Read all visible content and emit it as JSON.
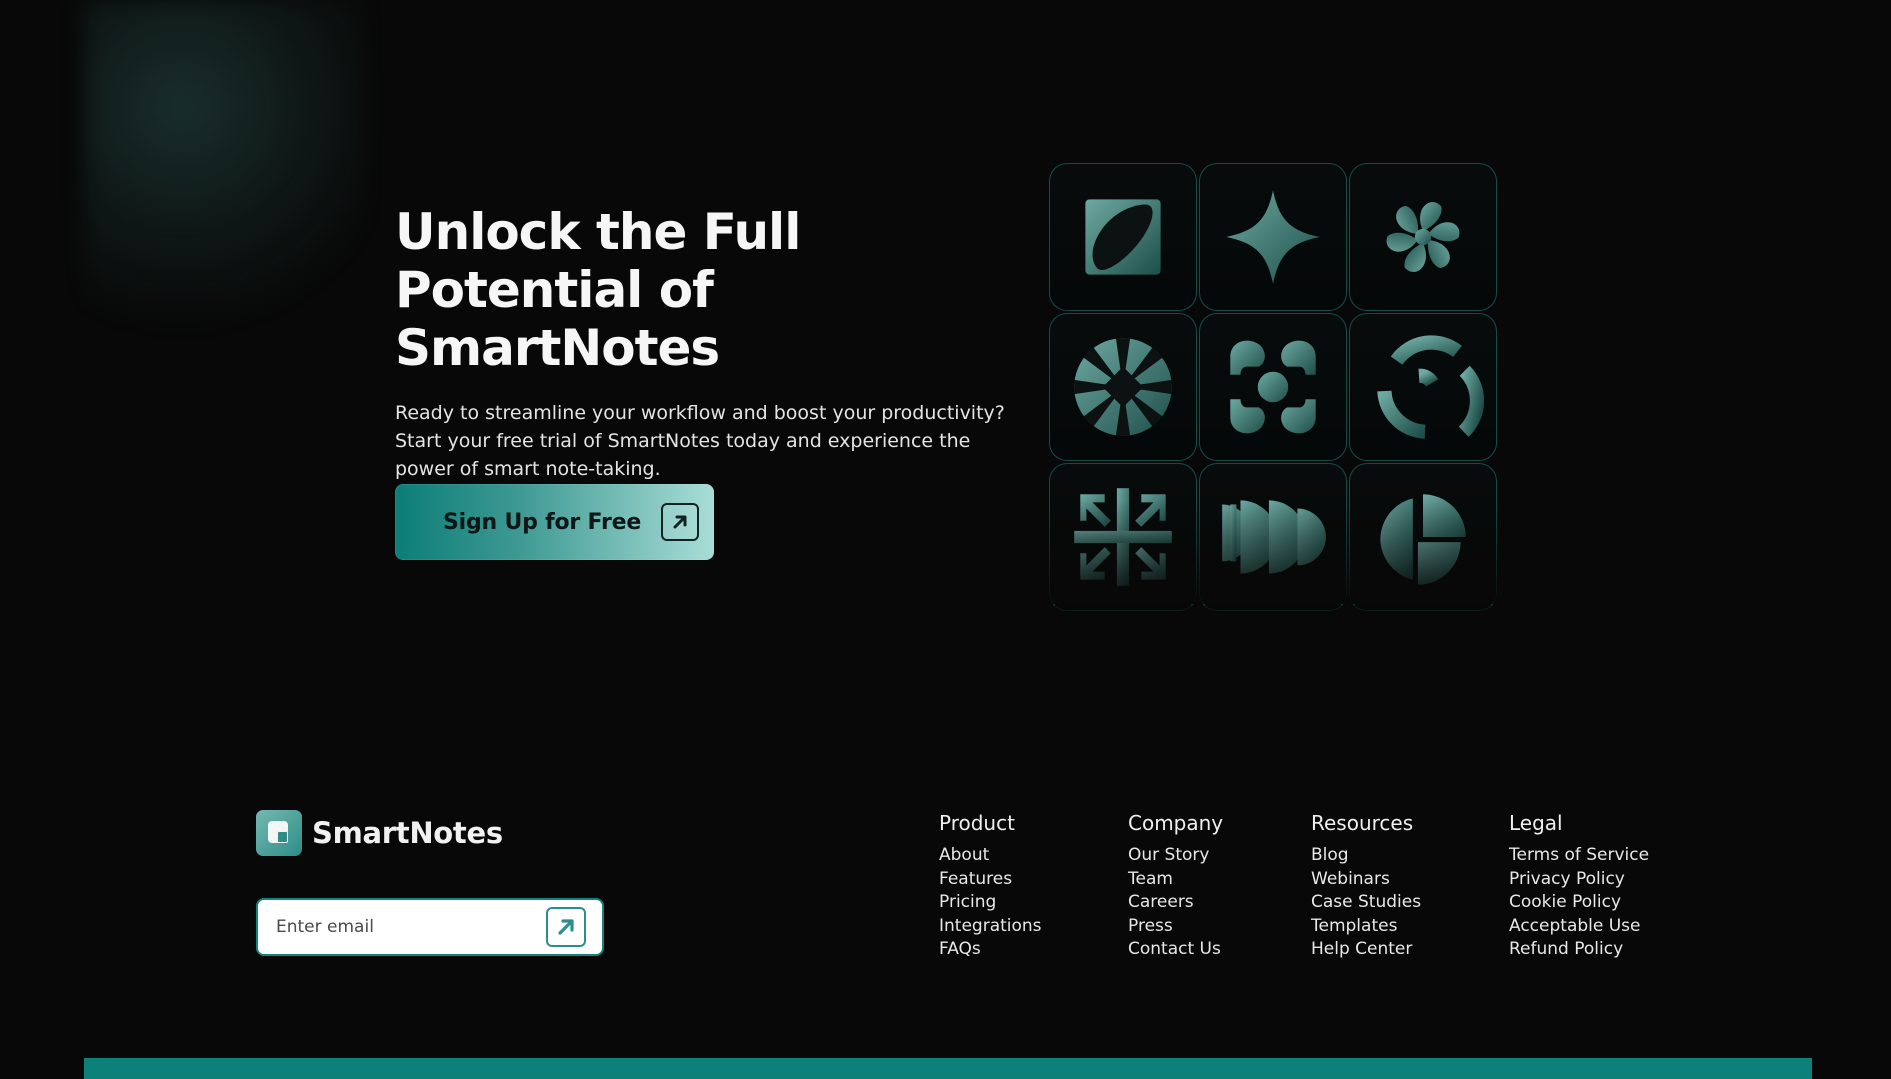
{
  "hero": {
    "title": "Unlock the Full Potential of SmartNotes",
    "description": "Ready to streamline your workflow and boost your productivity? Start your free trial of SmartNotes today and experience the power of smart note-taking.",
    "cta_label": "Sign Up for Free"
  },
  "icons": [
    "abstract-leaf-square-icon",
    "four-point-star-icon",
    "pinwheel-icon",
    "circular-flower-icon",
    "swirl-knot-icon",
    "arc-segments-icon",
    "inward-arrows-icon",
    "half-circles-icon",
    "circle-slices-icon"
  ],
  "footer": {
    "brand": "SmartNotes",
    "email_placeholder": "Enter email",
    "columns": [
      {
        "title": "Product",
        "links": [
          "About",
          "Features",
          "Pricing",
          "Integrations",
          "FAQs"
        ]
      },
      {
        "title": "Company",
        "links": [
          "Our Story",
          "Team",
          "Careers",
          "Press",
          "Contact Us"
        ]
      },
      {
        "title": "Resources",
        "links": [
          "Blog",
          "Webinars",
          "Case Studies",
          "Templates",
          "Help Center"
        ]
      },
      {
        "title": "Legal",
        "links": [
          "Terms of Service",
          "Privacy Policy",
          "Cookie Policy",
          "Acceptable Use",
          "Refund Policy"
        ]
      }
    ]
  },
  "colors": {
    "background": "#080808",
    "accent": "#0b8179",
    "accent_light": "#a9ddd7",
    "text": "#f3f3f3"
  }
}
